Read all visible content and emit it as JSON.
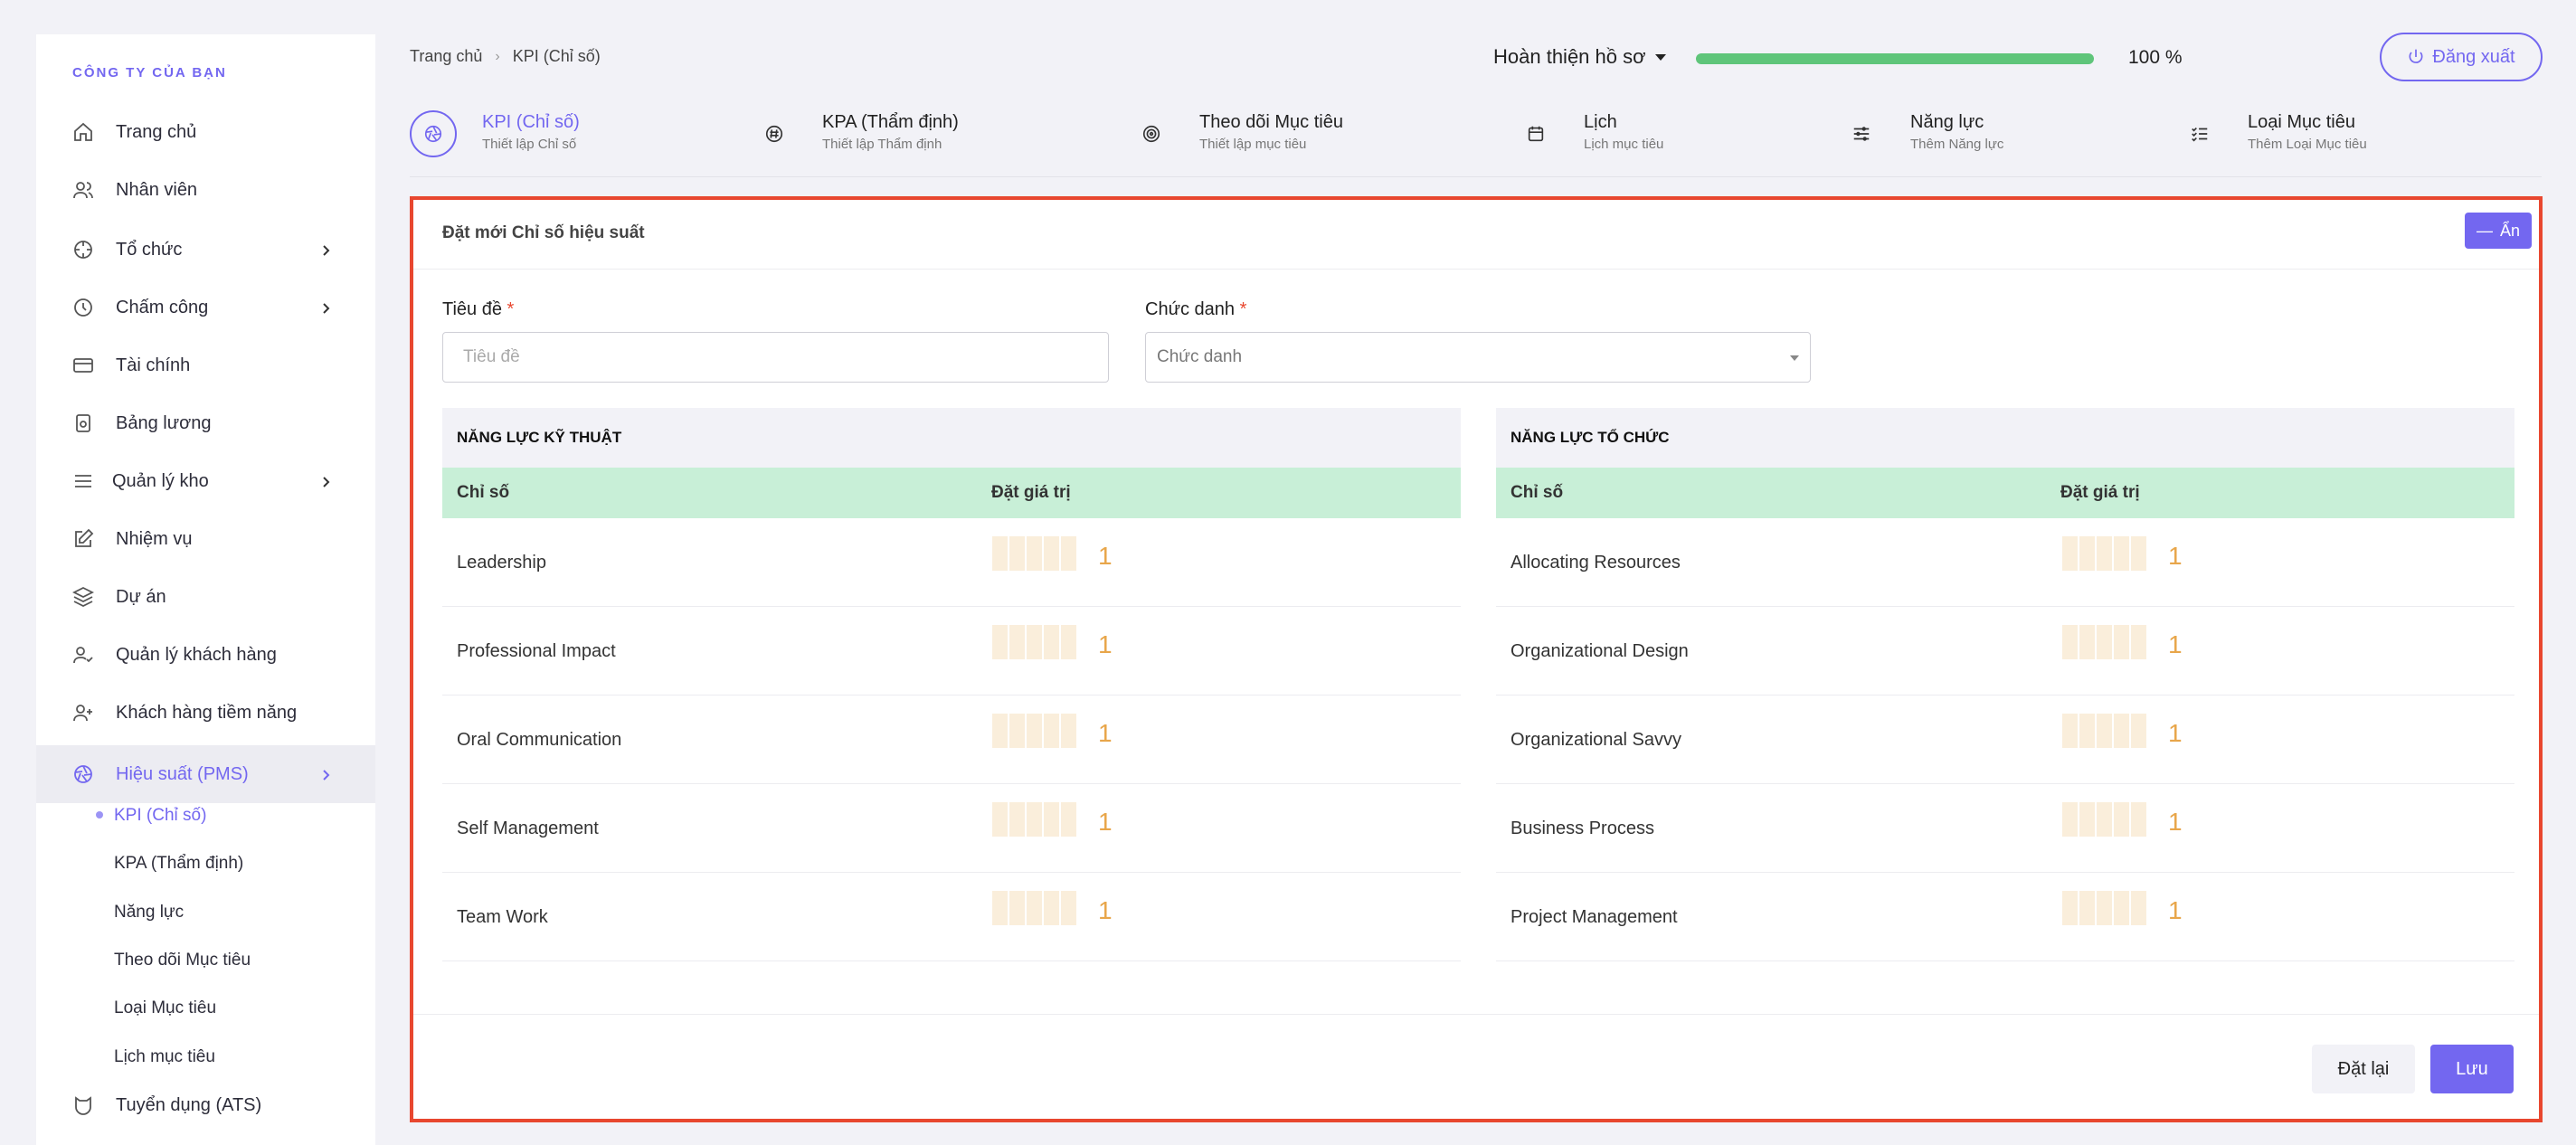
{
  "sidebar": {
    "company": "CÔNG TY CỦA BẠN",
    "items": [
      {
        "label": "Trang chủ",
        "icon": "home-icon"
      },
      {
        "label": "Nhân viên",
        "icon": "users-icon"
      },
      {
        "label": "Tổ chức",
        "icon": "crosshair-icon",
        "has_children": true
      },
      {
        "label": "Chấm công",
        "icon": "clock-icon",
        "has_children": true
      },
      {
        "label": "Tài chính",
        "icon": "credit-card-icon"
      },
      {
        "label": "Bảng lương",
        "icon": "payroll-icon"
      },
      {
        "label": "Quản lý kho",
        "icon": "menu-icon",
        "has_children": true
      },
      {
        "label": "Nhiệm vụ",
        "icon": "edit-icon"
      },
      {
        "label": "Dự án",
        "icon": "layers-icon"
      },
      {
        "label": "Quản lý khách hàng",
        "icon": "user-check-icon"
      },
      {
        "label": "Khách hàng tiềm năng",
        "icon": "user-plus-icon"
      },
      {
        "label": "Hiệu suất (PMS)",
        "icon": "aperture-icon",
        "has_children": true,
        "active": true
      },
      {
        "label": "Tuyển dụng (ATS)",
        "icon": "recruit-icon"
      }
    ],
    "sub_items": [
      {
        "label": "KPI (Chỉ số)",
        "active": true
      },
      {
        "label": "KPA (Thẩm định)"
      },
      {
        "label": "Năng lực"
      },
      {
        "label": "Theo dõi Mục tiêu"
      },
      {
        "label": "Loại Mục tiêu"
      },
      {
        "label": "Lịch mục tiêu"
      }
    ]
  },
  "header": {
    "breadcrumb": [
      "Trang chủ",
      "KPI (Chỉ số)"
    ],
    "profile_label": "Hoàn thiện hồ sơ",
    "progress": 100,
    "progress_text": "100 %",
    "logout_label": "Đăng xuất"
  },
  "tabs": [
    {
      "title": "KPI (Chỉ số)",
      "subtitle": "Thiết lập Chỉ số",
      "icon": "aperture-icon",
      "active": true
    },
    {
      "title": "KPA (Thẩm định)",
      "subtitle": "Thiết lập Thẩm định",
      "icon": "hash-icon"
    },
    {
      "title": "Theo dõi Mục tiêu",
      "subtitle": "Thiết lập mục tiêu",
      "icon": "target-icon"
    },
    {
      "title": "Lịch",
      "subtitle": "Lịch mục tiêu",
      "icon": "calendar-icon"
    },
    {
      "title": "Năng lực",
      "subtitle": "Thêm Năng lực",
      "icon": "sliders-icon"
    },
    {
      "title": "Loại Mục tiêu",
      "subtitle": "Thêm Loại Mục tiêu",
      "icon": "list-check-icon"
    }
  ],
  "form": {
    "card_title": "Đặt mới Chỉ số hiệu suất",
    "hide_label": "Ẩn",
    "title_label": "Tiêu đề",
    "title_placeholder": "Tiêu đề",
    "position_label": "Chức danh",
    "position_placeholder": "Chức danh",
    "required_mark": "*",
    "reset_label": "Đặt lại",
    "save_label": "Lưu"
  },
  "technical": {
    "heading": "NĂNG LỰC KỸ THUẬT",
    "col_indicator": "Chỉ số",
    "col_value": "Đặt giá trị",
    "rows": [
      {
        "name": "Leadership",
        "value": "1"
      },
      {
        "name": "Professional Impact",
        "value": "1"
      },
      {
        "name": "Oral Communication",
        "value": "1"
      },
      {
        "name": "Self Management",
        "value": "1"
      },
      {
        "name": "Team Work",
        "value": "1"
      }
    ]
  },
  "organizational": {
    "heading": "NĂNG LỰC TỔ CHỨC",
    "col_indicator": "Chỉ số",
    "col_value": "Đặt giá trị",
    "rows": [
      {
        "name": "Allocating Resources",
        "value": "1"
      },
      {
        "name": "Organizational Design",
        "value": "1"
      },
      {
        "name": "Organizational Savvy",
        "value": "1"
      },
      {
        "name": "Business Process",
        "value": "1"
      },
      {
        "name": "Project Management",
        "value": "1"
      }
    ]
  },
  "colors": {
    "accent": "#7367f0",
    "progress": "#5fc57a",
    "highlight_border": "#e8472f",
    "table_head": "#c8efd7",
    "rating_value": "#e8a64a"
  }
}
